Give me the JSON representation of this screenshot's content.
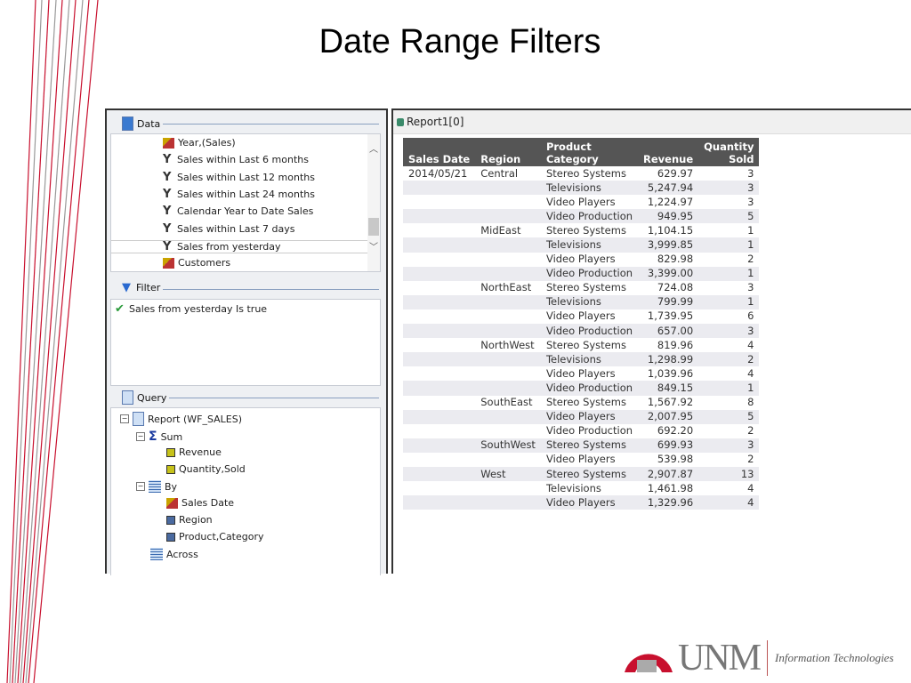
{
  "slide": {
    "title": "Date Range Filters"
  },
  "colors": {
    "accent_red": "#c8102e",
    "header_bg": "#555555",
    "row_alt": "#ebebf0"
  },
  "left_panel": {
    "data_section": {
      "label": "Data",
      "icon": "database-icon",
      "items": [
        {
          "label": "Year,(Sales)",
          "icon": "dimension-icon"
        },
        {
          "label": "Sales within Last 6 months",
          "icon": "filter-icon"
        },
        {
          "label": "Sales within Last 12 months",
          "icon": "filter-icon"
        },
        {
          "label": "Sales within Last 24 months",
          "icon": "filter-icon"
        },
        {
          "label": "Calendar Year to Date Sales",
          "icon": "filter-icon"
        },
        {
          "label": "Sales within Last 7 days",
          "icon": "filter-icon"
        },
        {
          "label": "Sales from yesterday",
          "icon": "filter-icon",
          "selected": true
        },
        {
          "label": "Customers",
          "icon": "dimension-icon"
        }
      ]
    },
    "filter_section": {
      "label": "Filter",
      "icon": "filter-icon",
      "items": [
        {
          "label": "Sales from yesterday Is true",
          "icon": "filter-check-icon"
        }
      ]
    },
    "query_section": {
      "label": "Query",
      "icon": "document-icon",
      "tree": {
        "report": "Report (WF_SALES)",
        "sum": "Sum",
        "sum_items": [
          "Revenue",
          "Quantity,Sold"
        ],
        "by": "By",
        "by_items": [
          "Sales Date",
          "Region",
          "Product,Category"
        ],
        "across": "Across"
      }
    }
  },
  "report": {
    "tab_title": "Report1[0]",
    "headers": [
      [
        "",
        "Sales Date"
      ],
      [
        "",
        "Region"
      ],
      [
        "Product",
        "Category"
      ],
      [
        "",
        "Revenue"
      ],
      [
        "Quantity",
        "Sold"
      ]
    ],
    "rows": [
      [
        "2014/05/21",
        "Central",
        "Stereo Systems",
        "629.97",
        "3"
      ],
      [
        "",
        "",
        "Televisions",
        "5,247.94",
        "3"
      ],
      [
        "",
        "",
        "Video Players",
        "1,224.97",
        "3"
      ],
      [
        "",
        "",
        "Video Production",
        "949.95",
        "5"
      ],
      [
        "",
        "MidEast",
        "Stereo Systems",
        "1,104.15",
        "1"
      ],
      [
        "",
        "",
        "Televisions",
        "3,999.85",
        "1"
      ],
      [
        "",
        "",
        "Video Players",
        "829.98",
        "2"
      ],
      [
        "",
        "",
        "Video Production",
        "3,399.00",
        "1"
      ],
      [
        "",
        "NorthEast",
        "Stereo Systems",
        "724.08",
        "3"
      ],
      [
        "",
        "",
        "Televisions",
        "799.99",
        "1"
      ],
      [
        "",
        "",
        "Video Players",
        "1,739.95",
        "6"
      ],
      [
        "",
        "",
        "Video Production",
        "657.00",
        "3"
      ],
      [
        "",
        "NorthWest",
        "Stereo Systems",
        "819.96",
        "4"
      ],
      [
        "",
        "",
        "Televisions",
        "1,298.99",
        "2"
      ],
      [
        "",
        "",
        "Video Players",
        "1,039.96",
        "4"
      ],
      [
        "",
        "",
        "Video Production",
        "849.15",
        "1"
      ],
      [
        "",
        "SouthEast",
        "Stereo Systems",
        "1,567.92",
        "8"
      ],
      [
        "",
        "",
        "Video Players",
        "2,007.95",
        "5"
      ],
      [
        "",
        "",
        "Video Production",
        "692.20",
        "2"
      ],
      [
        "",
        "SouthWest",
        "Stereo Systems",
        "699.93",
        "3"
      ],
      [
        "",
        "",
        "Video Players",
        "539.98",
        "2"
      ],
      [
        "",
        "West",
        "Stereo Systems",
        "2,907.87",
        "13"
      ],
      [
        "",
        "",
        "Televisions",
        "1,461.98",
        "4"
      ],
      [
        "",
        "",
        "Video Players",
        "1,329.96",
        "4"
      ]
    ]
  },
  "footer": {
    "logo_text": "UNM",
    "department": "Information Technologies"
  }
}
